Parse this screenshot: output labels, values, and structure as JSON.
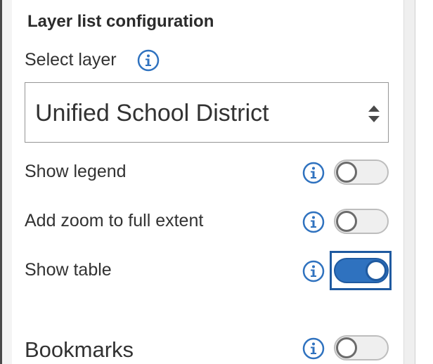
{
  "section": {
    "title": "Layer list configuration"
  },
  "select_layer": {
    "label": "Select layer",
    "value": "Unified School District"
  },
  "options": [
    {
      "label": "Show legend",
      "enabled": false
    },
    {
      "label": "Add zoom to full extent",
      "enabled": false
    },
    {
      "label": "Show table",
      "enabled": true
    },
    {
      "label": "Bookmarks",
      "enabled": false
    }
  ],
  "colors": {
    "accent": "#2f72bf",
    "text": "#323232",
    "toggle_off_bg": "#efefef"
  },
  "icons": {
    "info": "info-circle-icon",
    "select_arrows": "sort-arrows-icon"
  }
}
